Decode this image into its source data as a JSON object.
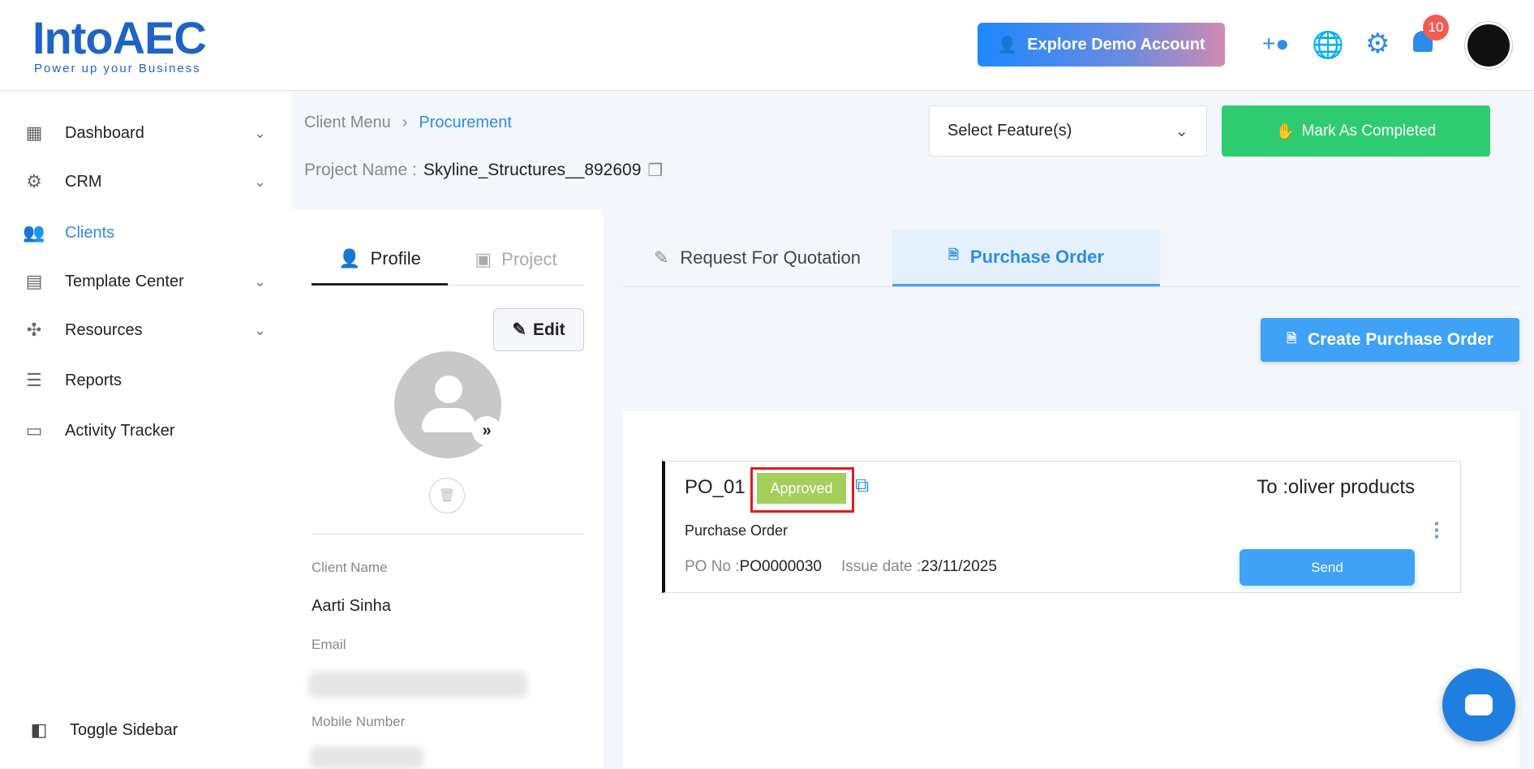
{
  "header": {
    "logo_main": "IntoAEC",
    "logo_tagline": "Power up your Business",
    "explore_label": "Explore Demo Account",
    "notification_count": "10"
  },
  "sidebar": {
    "items": [
      {
        "label": "Dashboard"
      },
      {
        "label": "CRM"
      },
      {
        "label": "Clients"
      },
      {
        "label": "Template Center"
      },
      {
        "label": "Resources"
      },
      {
        "label": "Reports"
      },
      {
        "label": "Activity Tracker"
      }
    ],
    "toggle_label": "Toggle Sidebar"
  },
  "breadcrumb": {
    "root": "Client Menu",
    "current": "Procurement"
  },
  "project": {
    "label": "Project Name :",
    "name": "Skyline_Structures__892609"
  },
  "toolbar": {
    "select_placeholder": "Select Feature(s)",
    "mark_completed": "Mark As Completed"
  },
  "profile": {
    "tabs": [
      "Profile",
      "Project"
    ],
    "edit_label": "Edit",
    "client_name_label": "Client Name",
    "client_name": "Aarti Sinha",
    "email_label": "Email",
    "mobile_label": "Mobile Number"
  },
  "main": {
    "tabs": [
      "Request For Quotation",
      "Purchase Order"
    ],
    "create_label": "Create Purchase Order"
  },
  "po": {
    "title": "PO_01",
    "status": "Approved",
    "to_label": "To :",
    "to": "oliver products",
    "type": "Purchase Order",
    "po_no_label": "PO No :",
    "po_no": "PO0000030",
    "issue_label": "Issue date :",
    "issue_date": "23/11/2025",
    "send_label": "Send"
  },
  "colors": {
    "accent": "#3fa2f7",
    "green": "#2ecc71",
    "approved": "#a3cf5a"
  }
}
